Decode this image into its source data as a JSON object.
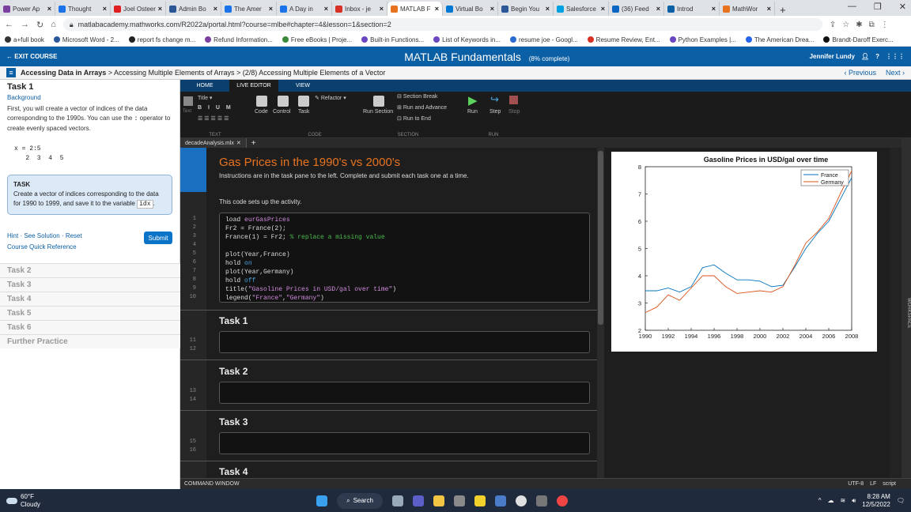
{
  "browser": {
    "tabs": [
      {
        "label": "Power Ap",
        "color": "#7b3fa0"
      },
      {
        "label": "Thought",
        "color": "#1a73e8"
      },
      {
        "label": "Joel Osteen",
        "color": "#e02020"
      },
      {
        "label": "Admin Bo",
        "color": "#2b5797"
      },
      {
        "label": "The Amer",
        "color": "#1a73e8"
      },
      {
        "label": "A Day in",
        "color": "#1a73e8"
      },
      {
        "label": "Inbox - je",
        "color": "#d93025"
      },
      {
        "label": "MATLAB F",
        "color": "#e8731e",
        "active": true
      },
      {
        "label": "Virtual Bo",
        "color": "#0078d4"
      },
      {
        "label": "Begin You",
        "color": "#2b5797"
      },
      {
        "label": "Salesforce",
        "color": "#00a1e0"
      },
      {
        "label": "(36) Feed",
        "color": "#0a66c2"
      },
      {
        "label": "Introd",
        "color": "#0b5fa5"
      },
      {
        "label": "MathWor",
        "color": "#e8731e"
      }
    ],
    "url": "matlabacademy.mathworks.com/R2022a/portal.html?course=mlbe#chapter=4&lesson=1&section=2",
    "bookmarks": [
      "a+full book",
      "Microsoft Word - 2...",
      "report fs change m...",
      "Refund Information...",
      "Free eBooks | Proje...",
      "Built-in Functions...",
      "List of Keywords in...",
      "resume joe - Googl...",
      "Resume Review, Ent...",
      "Python Examples |...",
      "The American Drea...",
      "Brandt-Daroff Exerc..."
    ]
  },
  "header": {
    "exit": "← EXIT COURSE",
    "title": "MATLAB Fundamentals",
    "progress": "(8% complete)",
    "user": "Jennifer Lundy"
  },
  "breadcrumb": {
    "bold": "Accessing Data in Arrays",
    "rest": " > Accessing Multiple Elements of Arrays > (2/8) Accessing Multiple Elements of a Vector",
    "previous": "‹ Previous",
    "next": "Next ›"
  },
  "left": {
    "task_title": "Task 1",
    "background_link": "Background",
    "bg_text_1": "First, you will create a vector of indices of the data corresponding to the 1990s.  You can use the ",
    "bg_code": ":",
    "bg_text_2": " operator to create evenly spaced vectors.",
    "code_sample": "x = 2:5\n   2  3  4  5",
    "task_heading": "TASK",
    "task_text": "Create a vector of indices corresponding to the data for 1990 to 1999, and save it to the variable ",
    "task_var": "idx",
    "task_end": ".",
    "hint": "Hint",
    "see_solution": "See Solution",
    "reset": "Reset",
    "reference": "Course Quick Reference",
    "submit": "Submit",
    "tasks": [
      "Task 2",
      "Task 3",
      "Task 4",
      "Task 5",
      "Task 6",
      "Further Practice"
    ]
  },
  "ribbon": {
    "tabs": [
      "HOME",
      "LIVE EDITOR",
      "VIEW"
    ],
    "active_tab": "LIVE EDITOR",
    "text_label": "TEXT",
    "code_label": "CODE",
    "section_label": "SECTION",
    "run_label": "RUN",
    "title_dd": "Title",
    "text": "Text",
    "code": "Code",
    "control": "Control",
    "task": "Task",
    "refactor": "Refactor",
    "section_break": "Section Break",
    "run_advance": "Run and Advance",
    "run_to_end": "Run to End",
    "run_section": "Run Section",
    "run": "Run",
    "step": "Step",
    "stop": "Stop"
  },
  "doc_tab": "decadeAnalysis.mlx",
  "live": {
    "title": "Gas Prices in the 1990's vs 2000's",
    "subtitle": "Instructions are in the task pane to the left. Complete and submit each task one at a time.",
    "setup_text": "This code sets up the activity.",
    "task1": "Task 1",
    "task2": "Task 2",
    "task3": "Task 3",
    "task4": "Task 4"
  },
  "cmd": {
    "label": "COMMAND WINDOW",
    "encoding": "UTF-8",
    "eol": "LF",
    "mode": "script",
    "workspace": "WORKSPACE"
  },
  "chart_data": {
    "type": "line",
    "title": "Gasoline Prices in USD/gal over time",
    "xlabel": "",
    "ylabel": "",
    "xlim": [
      1990,
      2008
    ],
    "ylim": [
      2,
      8
    ],
    "xticks": [
      1990,
      1992,
      1994,
      1996,
      1998,
      2000,
      2002,
      2004,
      2006,
      2008
    ],
    "yticks": [
      2,
      3,
      4,
      5,
      6,
      7,
      8
    ],
    "legend_position": "top-right",
    "x": [
      1990,
      1991,
      1992,
      1993,
      1994,
      1995,
      1996,
      1997,
      1998,
      1999,
      2000,
      2001,
      2002,
      2003,
      2004,
      2005,
      2006,
      2007,
      2008
    ],
    "series": [
      {
        "name": "France",
        "color": "#0072bd",
        "values": [
          3.45,
          3.45,
          3.55,
          3.4,
          3.6,
          4.3,
          4.4,
          4.1,
          3.85,
          3.85,
          3.8,
          3.6,
          3.65,
          4.3,
          5.0,
          5.55,
          6.0,
          6.8,
          7.6
        ]
      },
      {
        "name": "Germany",
        "color": "#d95319",
        "values": [
          2.65,
          2.85,
          3.3,
          3.1,
          3.55,
          4.0,
          4.0,
          3.6,
          3.35,
          3.4,
          3.45,
          3.4,
          3.6,
          4.35,
          5.2,
          5.6,
          6.1,
          7.0,
          7.85
        ]
      }
    ]
  },
  "taskbar": {
    "temp": "60°F",
    "condition": "Cloudy",
    "search": "Search",
    "time": "8:28 AM",
    "date": "12/5/2022"
  }
}
